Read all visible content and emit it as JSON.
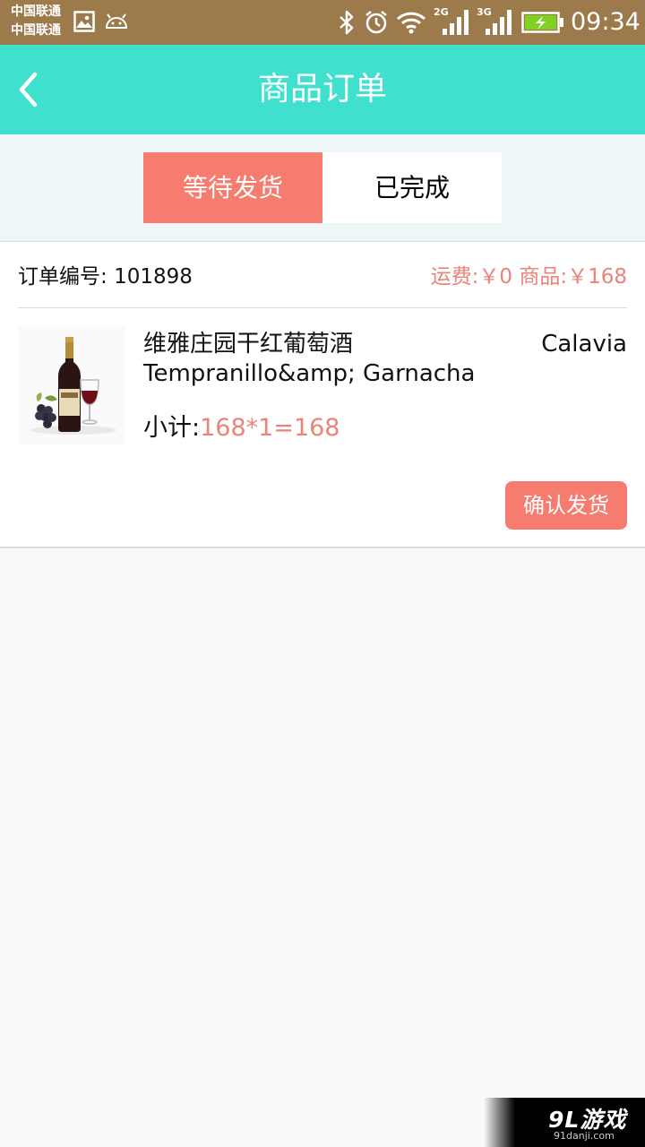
{
  "statusbar": {
    "carrier_1": "中国联通",
    "carrier_2": "中国联通",
    "net_2g": "2G",
    "net_3g": "3G",
    "time": "09:34"
  },
  "header": {
    "title": "商品订单",
    "back_icon": "chevron-left-icon"
  },
  "tabs": [
    {
      "label": "等待发货",
      "active": true
    },
    {
      "label": "已完成",
      "active": false
    }
  ],
  "order": {
    "id_label": "订单编号:",
    "id_value": "101898",
    "fees": "运费:￥0 商品:￥168",
    "product": {
      "name": "维雅庄园干红葡萄酒 Tempranillo&amp; Garnacha",
      "brand": "Calavia",
      "subtotal_label": "小计:",
      "subtotal_value": "168*1=168"
    },
    "confirm_label": "确认发货"
  },
  "watermark": {
    "logo": "9L游戏",
    "url": "91danji.com"
  },
  "colors": {
    "accent": "#40e0cf",
    "salmon": "#f57c6e",
    "price": "#e8847a",
    "statusbar": "#9c7a4c"
  }
}
